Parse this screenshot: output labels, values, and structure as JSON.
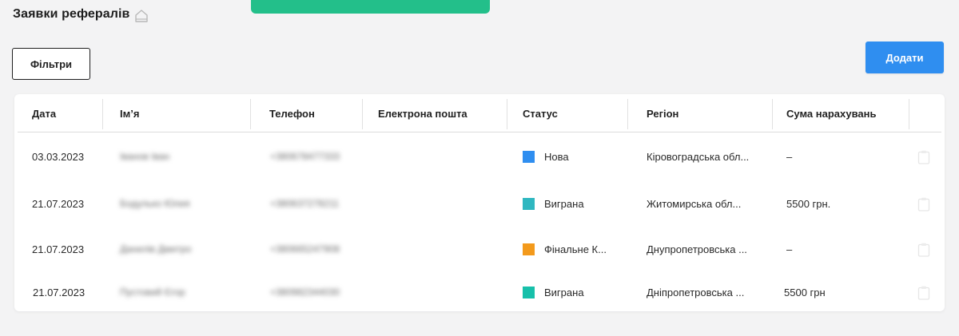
{
  "header": {
    "title": "Заявки рефералів",
    "home_icon": "home-icon"
  },
  "toolbar": {
    "filters_label": "Фільтри",
    "add_label": "Додати"
  },
  "colors": {
    "accent_green": "#23bf8a",
    "primary_blue": "#2f8ef0",
    "status_new": "#2f8ef0",
    "status_won": "#2fb7c0",
    "status_final": "#f39a1c",
    "status_won_alt": "#17c0aa"
  },
  "table": {
    "columns": [
      "Дата",
      "Ім’я",
      "Телефон",
      "Електрона пошта",
      "Статус",
      "Регіон",
      "Сума нарахувань"
    ],
    "rows": [
      {
        "date": "03.03.2023",
        "name": "Іванов Іван",
        "phone": "+380678477333",
        "email": "",
        "status": "Нова",
        "status_color": "#2f8ef0",
        "region": "Кіровоградська обл...",
        "sum": "–",
        "action_icon": "clipboard-icon"
      },
      {
        "date": "21.07.2023",
        "name": "Бодулько Юлия",
        "phone": "+380637278211",
        "email": "",
        "status": "Виграна",
        "status_color": "#2fb7c0",
        "region": "Житомирська обл...",
        "sum": "5500 грн.",
        "action_icon": "clipboard-icon"
      },
      {
        "date": "21.07.2023",
        "name": "Данилів Дмитро",
        "phone": "+380665247908",
        "email": "",
        "status": "Фінальне К...",
        "status_color": "#f39a1c",
        "region": "Днупропетровська ...",
        "sum": "–",
        "action_icon": "clipboard-icon"
      },
      {
        "date": "21.07.2023",
        "name": "Пустовий Єгор",
        "phone": "+380982344030",
        "email": "",
        "status": "Виграна",
        "status_color": "#17c0aa",
        "region": "Дніпропетровська ...",
        "sum": "5500 грн",
        "action_icon": "clipboard-icon"
      }
    ]
  }
}
